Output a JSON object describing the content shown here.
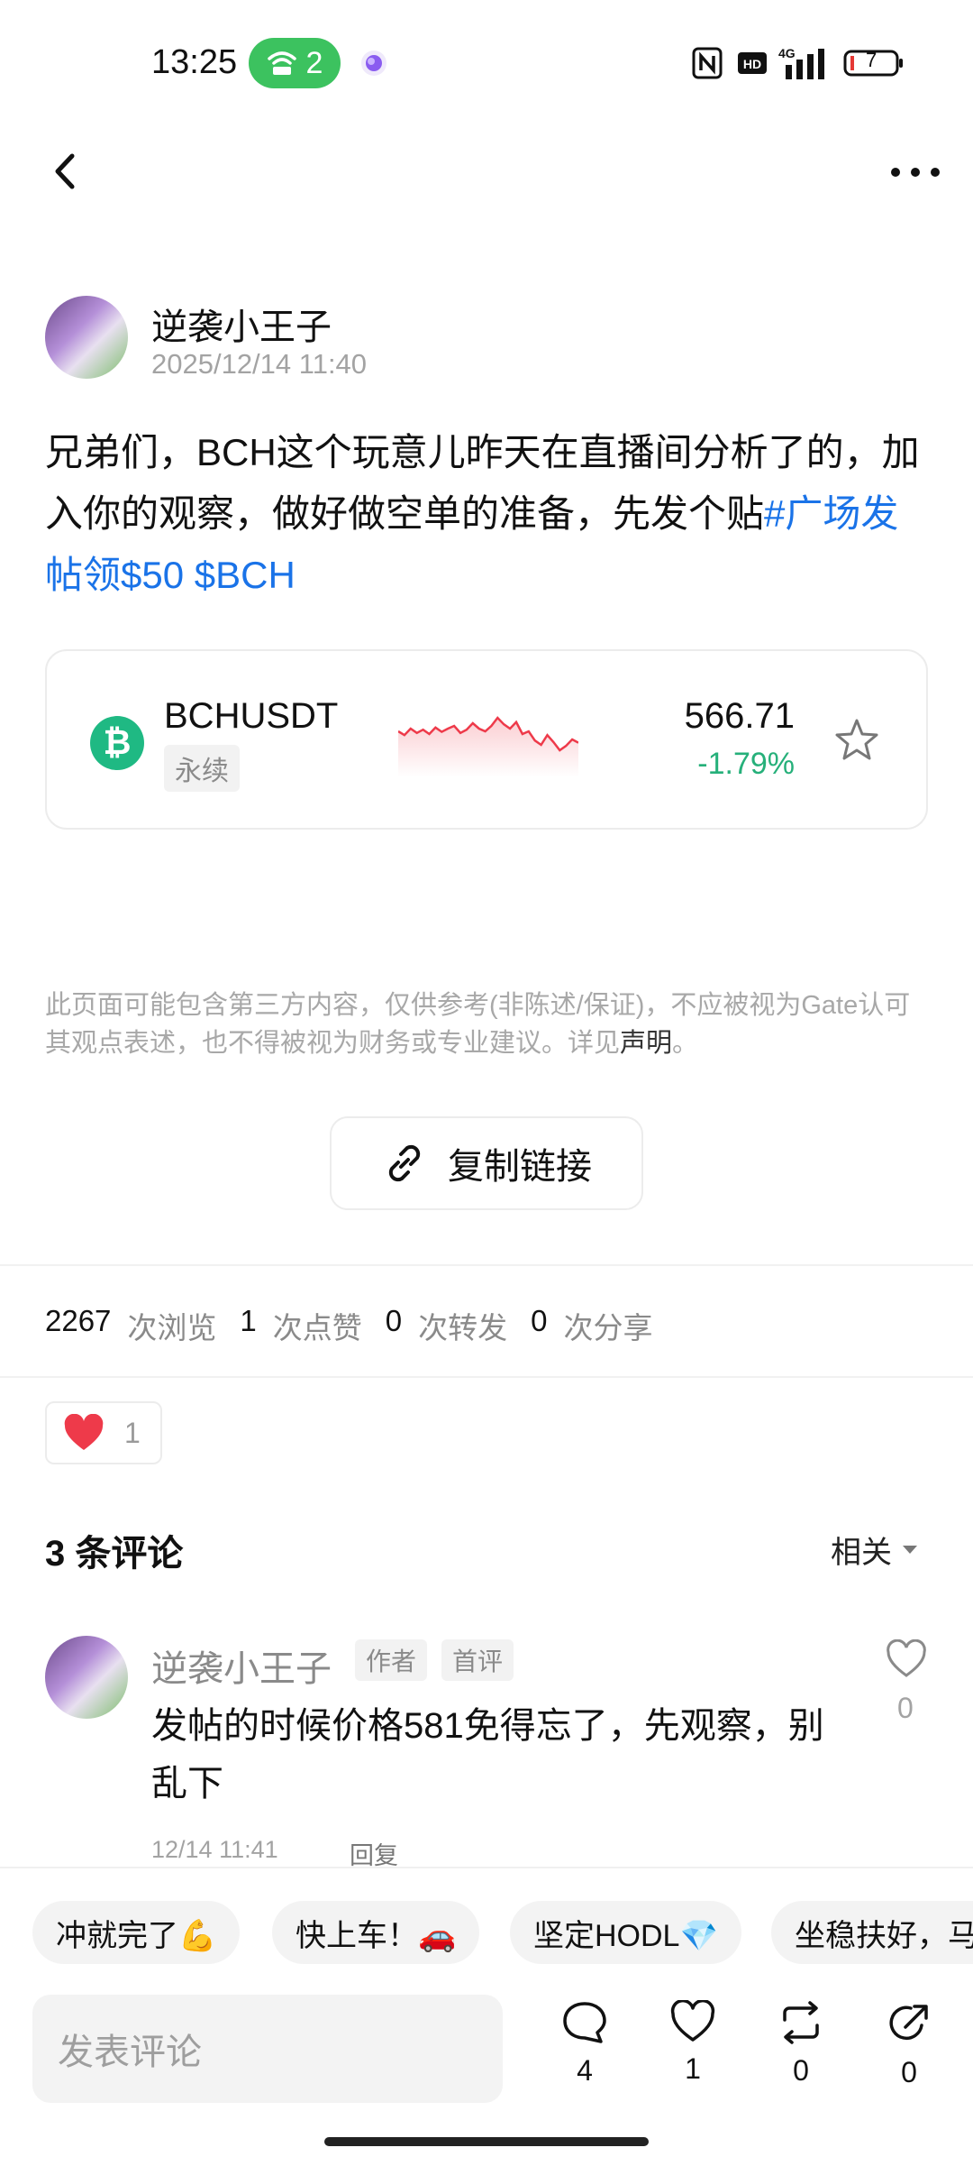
{
  "status_bar": {
    "time": "13:25",
    "hotspot_count": "2",
    "network": "4G",
    "battery": "7",
    "icons": [
      "wifi-hotspot-icon",
      "app-bubble-icon",
      "nfc-icon",
      "hd-icon",
      "signal-icon",
      "battery-icon"
    ]
  },
  "header": {
    "back_icon": "chevron-left-icon",
    "more_icon": "more-dots-icon"
  },
  "post": {
    "author": "逆袭小王子",
    "time": "2025/12/14 11:40",
    "text": "兄弟们，BCH这个玩意儿昨天在直播间分析了的，加入你的观察，做好做空单的准备，先发个贴",
    "hashtag": "#广场发帖领$50",
    "cashtag": "$BCH"
  },
  "ticker": {
    "symbol": "BCHUSDT",
    "type": "永续",
    "price": "566.71",
    "change": "-1.79%",
    "coin_icon": "bitcoin-cash-icon",
    "star_icon": "star-outline-icon",
    "sparkline": [
      0.55,
      0.62,
      0.5,
      0.58,
      0.52,
      0.6,
      0.48,
      0.56,
      0.5,
      0.45,
      0.58,
      0.52,
      0.4,
      0.5,
      0.55,
      0.45,
      0.3,
      0.42,
      0.5,
      0.38,
      0.6,
      0.55,
      0.72,
      0.8,
      0.62,
      0.75,
      0.9,
      0.82,
      0.7,
      0.76
    ]
  },
  "disclaimer": {
    "text": "此页面可能包含第三方内容，仅供参考(非陈述/保证)，不应被视为Gate认可其观点表述，也不得被视为财务或专业建议。详见",
    "link": "声明",
    "end": "。"
  },
  "copy_link": {
    "label": "复制链接",
    "icon": "link-icon"
  },
  "stats": [
    {
      "value": "2267",
      "label": "次浏览"
    },
    {
      "value": "1",
      "label": "次点赞"
    },
    {
      "value": "0",
      "label": "次转发"
    },
    {
      "value": "0",
      "label": "次分享"
    }
  ],
  "reactions": {
    "count": "1",
    "icon": "heart-filled-icon"
  },
  "comments": {
    "title": "3 条评论",
    "sort": "相关",
    "items": [
      {
        "author": "逆袭小王子",
        "badge_author": "作者",
        "badge_first": "首评",
        "text": "发帖的时候价格581免得忘了，先观察，别乱下",
        "time": "12/14 11:41",
        "reply": "回复",
        "likes": "0"
      }
    ]
  },
  "quick_replies": [
    "冲就完了💪",
    "快上车！🚗",
    "坚定HODL💎",
    "坐稳扶好，马"
  ],
  "composer": {
    "placeholder": "发表评论",
    "actions": [
      {
        "icon": "comment-icon",
        "count": "4"
      },
      {
        "icon": "heart-outline-icon",
        "count": "1"
      },
      {
        "icon": "repost-icon",
        "count": "0"
      },
      {
        "icon": "share-icon",
        "count": "0"
      }
    ]
  },
  "colors": {
    "accent": "#1a73e8",
    "down": "#26b07a",
    "like": "#ee3a4a",
    "hotspot": "#3cc25f"
  }
}
